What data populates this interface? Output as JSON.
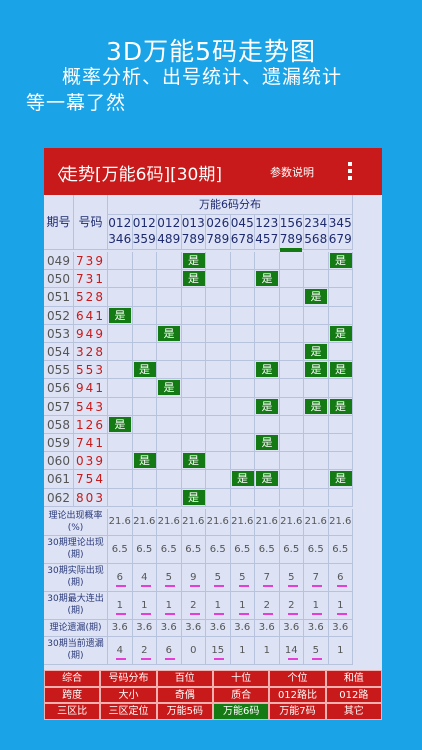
{
  "promo": {
    "title": "3D万能5码走势图",
    "line1": "概率分析、出号统计、遗漏统计",
    "line2": "等一幕了然"
  },
  "appbar": {
    "back": "〈",
    "title": "走势[万能6码][30期]",
    "params": "参数说明",
    "menu_icon": "more-vertical-icon"
  },
  "table": {
    "head_issue": "期号",
    "head_code": "号码",
    "head_dist": "万能6码分布",
    "columns": [
      {
        "a": "012",
        "b": "346"
      },
      {
        "a": "012",
        "b": "359"
      },
      {
        "a": "012",
        "b": "489"
      },
      {
        "a": "013",
        "b": "789"
      },
      {
        "a": "026",
        "b": "789"
      },
      {
        "a": "045",
        "b": "678"
      },
      {
        "a": "123",
        "b": "457"
      },
      {
        "a": "156",
        "b": "789"
      },
      {
        "a": "234",
        "b": "568"
      },
      {
        "a": "345",
        "b": "679"
      }
    ],
    "yes_text": "是",
    "rows": [
      {
        "issue": "049",
        "code": "739",
        "hits": [
          3,
          9
        ]
      },
      {
        "issue": "050",
        "code": "731",
        "hits": [
          3,
          6
        ]
      },
      {
        "issue": "051",
        "code": "528",
        "hits": [
          8
        ]
      },
      {
        "issue": "052",
        "code": "641",
        "hits": [
          0
        ]
      },
      {
        "issue": "053",
        "code": "949",
        "hits": [
          2,
          9
        ]
      },
      {
        "issue": "054",
        "code": "328",
        "hits": [
          8
        ]
      },
      {
        "issue": "055",
        "code": "553",
        "hits": [
          1,
          6,
          8,
          9
        ]
      },
      {
        "issue": "056",
        "code": "941",
        "hits": [
          2
        ]
      },
      {
        "issue": "057",
        "code": "543",
        "hits": [
          6,
          8,
          9
        ]
      },
      {
        "issue": "058",
        "code": "126",
        "hits": [
          0
        ]
      },
      {
        "issue": "059",
        "code": "741",
        "hits": [
          6
        ]
      },
      {
        "issue": "060",
        "code": "039",
        "hits": [
          1,
          3
        ]
      },
      {
        "issue": "061",
        "code": "754",
        "hits": [
          5,
          6,
          9
        ]
      },
      {
        "issue": "062",
        "code": "803",
        "hits": [
          3
        ]
      }
    ],
    "stats": [
      {
        "label": "理论出现概率(%)",
        "values": [
          "21.6",
          "21.6",
          "21.6",
          "21.6",
          "21.6",
          "21.6",
          "21.6",
          "21.6",
          "21.6",
          "21.6"
        ],
        "bars": []
      },
      {
        "label": "30期理论出现(期)",
        "values": [
          "6.5",
          "6.5",
          "6.5",
          "6.5",
          "6.5",
          "6.5",
          "6.5",
          "6.5",
          "6.5",
          "6.5"
        ],
        "bars": []
      },
      {
        "label": "30期实际出现(期)",
        "values": [
          "6",
          "4",
          "5",
          "9",
          "5",
          "5",
          "7",
          "5",
          "7",
          "6"
        ],
        "bars": [
          0,
          1,
          2,
          3,
          4,
          5,
          6,
          7,
          8,
          9
        ]
      },
      {
        "label": "30期最大连出(期)",
        "values": [
          "1",
          "1",
          "1",
          "2",
          "1",
          "1",
          "2",
          "2",
          "1",
          "1"
        ],
        "bars": [
          0,
          1,
          2,
          3,
          4,
          5,
          6,
          7,
          8,
          9
        ]
      },
      {
        "label": "理论遗漏(期)",
        "values": [
          "3.6",
          "3.6",
          "3.6",
          "3.6",
          "3.6",
          "3.6",
          "3.6",
          "3.6",
          "3.6",
          "3.6"
        ],
        "bars": []
      },
      {
        "label": "30期当前遗漏(期)",
        "values": [
          "4",
          "2",
          "6",
          "0",
          "15",
          "1",
          "1",
          "14",
          "5",
          "1"
        ],
        "bars": [
          0,
          1,
          2,
          4,
          7,
          8
        ]
      }
    ]
  },
  "buttons": [
    [
      "综合",
      "号码分布",
      "百位",
      "十位",
      "个位",
      "和值"
    ],
    [
      "跨度",
      "大小",
      "奇偶",
      "质合",
      "012路比",
      "012路"
    ],
    [
      "三区比",
      "三区定位",
      "万能5码",
      "万能6码",
      "万能7码",
      "其它"
    ]
  ],
  "selected_button": "万能6码"
}
